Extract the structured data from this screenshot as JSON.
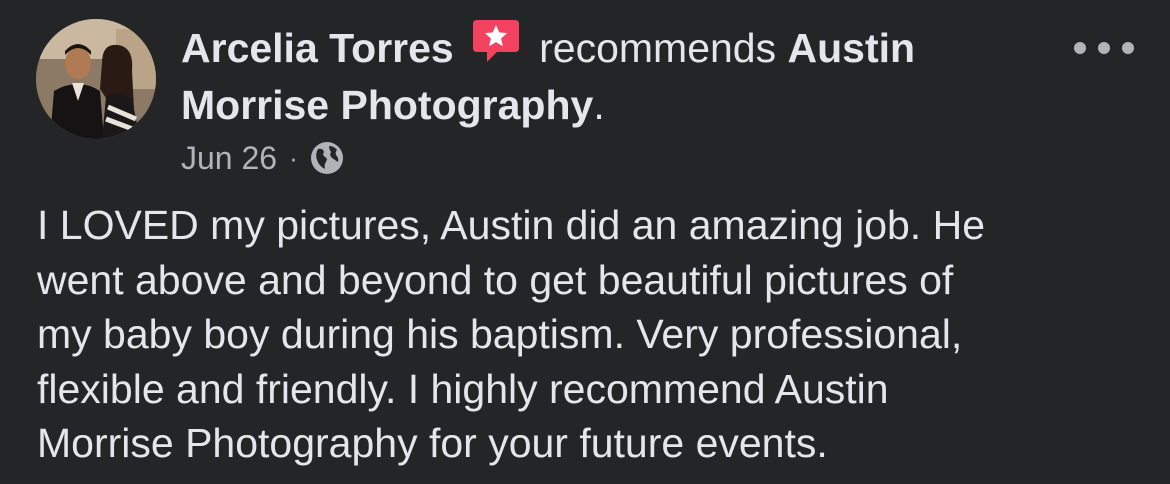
{
  "post": {
    "author": "Arcelia Torres",
    "verb": "recommends",
    "page_name": "Austin Morrise Photography",
    "page_suffix": ".",
    "date": "Jun 26",
    "separator": "·",
    "privacy_icon": "globe-icon",
    "rec_icon": "recommendation-star-icon",
    "menu_icon": "more-options-icon",
    "body_lines": [
      "I LOVED my pictures, Austin did an amazing job. He",
      "went above and beyond to get beautiful pictures of",
      "my baby boy during his baptism. Very professional,",
      "flexible and friendly. I highly recommend Austin",
      "Morrise Photography for your future events."
    ]
  },
  "colors": {
    "background": "#242526",
    "primary_text": "#e4e6eb",
    "secondary_text": "#b0b3b8",
    "badge": "#f3425f"
  }
}
